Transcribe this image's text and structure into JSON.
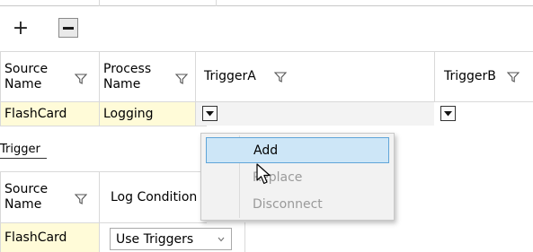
{
  "toolbar": {
    "add_glyph": "+",
    "remove_glyph": "−"
  },
  "grid1": {
    "headers": [
      {
        "label": "Source\nName",
        "filter": "filter-icon"
      },
      {
        "label": "Process\nName",
        "filter": "filter-icon"
      },
      {
        "label": "TriggerA",
        "filter": "filter-icon"
      },
      {
        "label": "TriggerB",
        "filter": "filter-icon"
      }
    ],
    "row": {
      "source_name": "FlashCard",
      "process_name": "Logging"
    }
  },
  "section": {
    "label": "Trigger"
  },
  "grid2": {
    "headers": [
      {
        "label": "Source\nName",
        "filter": "filter-icon"
      },
      {
        "label": "Log Condition",
        "filter": ""
      }
    ],
    "row": {
      "source_name": "FlashCard",
      "log_condition": "Use Triggers"
    }
  },
  "context_menu": {
    "items": [
      {
        "label": "Add",
        "state": "highlighted"
      },
      {
        "label": "Replace",
        "state": "disabled"
      },
      {
        "label": "Disconnect",
        "state": "disabled"
      }
    ]
  },
  "colors": {
    "highlight_bg": "#cde6f7",
    "highlight_border": "#5fa5d8",
    "yellow_cell": "#fffbd8",
    "grid_line": "#d9d9d9"
  }
}
